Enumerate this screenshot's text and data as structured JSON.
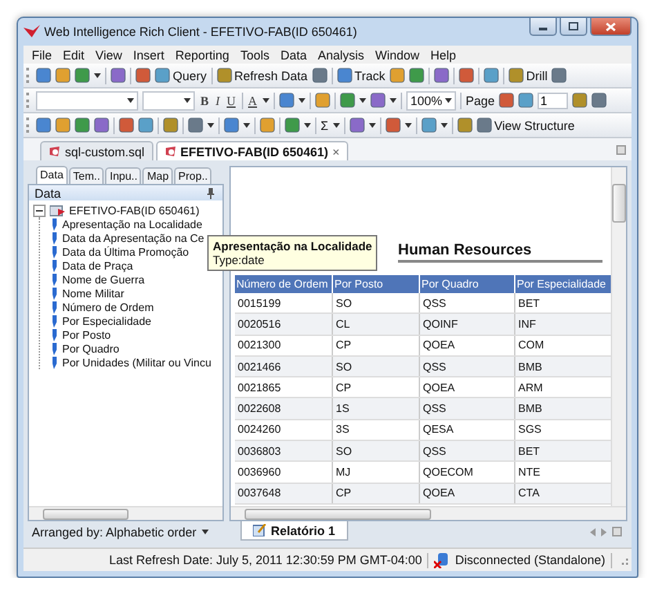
{
  "window": {
    "title": "Web Intelligence Rich Client - EFETIVO-FAB(ID 650461)"
  },
  "menu": [
    "File",
    "Edit",
    "View",
    "Insert",
    "Reporting",
    "Tools",
    "Data",
    "Analysis",
    "Window",
    "Help"
  ],
  "toolbars": [
    [
      {
        "kind": "icon"
      },
      {
        "kind": "icon"
      },
      {
        "kind": "icon"
      },
      {
        "kind": "caret"
      },
      {
        "kind": "sep"
      },
      {
        "kind": "icon"
      },
      {
        "kind": "sep"
      },
      {
        "kind": "icon"
      },
      {
        "kind": "button",
        "label": "Query"
      },
      {
        "kind": "sep"
      },
      {
        "kind": "button",
        "label": "Refresh Data"
      },
      {
        "kind": "icon"
      },
      {
        "kind": "sep"
      },
      {
        "kind": "button",
        "label": "Track"
      },
      {
        "kind": "icon"
      },
      {
        "kind": "icon"
      },
      {
        "kind": "sep"
      },
      {
        "kind": "icon"
      },
      {
        "kind": "sep"
      },
      {
        "kind": "icon"
      },
      {
        "kind": "sep"
      },
      {
        "kind": "icon"
      },
      {
        "kind": "sep"
      },
      {
        "kind": "button",
        "label": "Drill"
      },
      {
        "kind": "icon"
      }
    ],
    [
      {
        "kind": "font-combo"
      },
      {
        "kind": "size-combo"
      },
      {
        "kind": "bold",
        "label": "B"
      },
      {
        "kind": "italic",
        "label": "I"
      },
      {
        "kind": "underline",
        "label": "U"
      },
      {
        "kind": "sep"
      },
      {
        "kind": "underline",
        "label": "A"
      },
      {
        "kind": "caret"
      },
      {
        "kind": "sep"
      },
      {
        "kind": "icon"
      },
      {
        "kind": "caret"
      },
      {
        "kind": "sep"
      },
      {
        "kind": "icon"
      },
      {
        "kind": "sep"
      },
      {
        "kind": "icon"
      },
      {
        "kind": "caret"
      },
      {
        "kind": "icon"
      },
      {
        "kind": "caret"
      },
      {
        "kind": "sep"
      },
      {
        "kind": "zoom",
        "label": "100%"
      },
      {
        "kind": "sep"
      },
      {
        "kind": "text",
        "label": "Page"
      },
      {
        "kind": "icon"
      },
      {
        "kind": "icon"
      },
      {
        "kind": "page-field",
        "value": "1"
      },
      {
        "kind": "icon"
      },
      {
        "kind": "icon"
      }
    ],
    [
      {
        "kind": "icon"
      },
      {
        "kind": "icon"
      },
      {
        "kind": "icon"
      },
      {
        "kind": "icon"
      },
      {
        "kind": "sep"
      },
      {
        "kind": "icon"
      },
      {
        "kind": "icon"
      },
      {
        "kind": "sep"
      },
      {
        "kind": "icon"
      },
      {
        "kind": "sep"
      },
      {
        "kind": "icon"
      },
      {
        "kind": "caret"
      },
      {
        "kind": "sep"
      },
      {
        "kind": "icon"
      },
      {
        "kind": "caret"
      },
      {
        "kind": "sep"
      },
      {
        "kind": "icon"
      },
      {
        "kind": "sep"
      },
      {
        "kind": "icon"
      },
      {
        "kind": "caret"
      },
      {
        "kind": "sep"
      },
      {
        "kind": "text",
        "label": "Σ"
      },
      {
        "kind": "caret"
      },
      {
        "kind": "sep"
      },
      {
        "kind": "icon"
      },
      {
        "kind": "caret"
      },
      {
        "kind": "sep"
      },
      {
        "kind": "icon"
      },
      {
        "kind": "caret"
      },
      {
        "kind": "sep"
      },
      {
        "kind": "icon"
      },
      {
        "kind": "caret"
      },
      {
        "kind": "sep"
      },
      {
        "kind": "icon"
      },
      {
        "kind": "button",
        "label": "View Structure"
      }
    ]
  ],
  "document_tabs": [
    {
      "label": "sql-custom.sql",
      "selected": false
    },
    {
      "label": "EFETIVO-FAB(ID 650461)",
      "selected": true,
      "close": "×"
    }
  ],
  "side_panel": {
    "tabs": [
      {
        "label": "Data",
        "selected": true
      },
      {
        "label": "Tem..",
        "selected": false
      },
      {
        "label": "Inpu..",
        "selected": false
      },
      {
        "label": "Map",
        "selected": false
      },
      {
        "label": "Prop..",
        "selected": false
      }
    ],
    "header": "Data",
    "tree": [
      {
        "label": "EFETIVO-FAB(ID 650461)",
        "expanded": true,
        "children": [
          {
            "label": "Apresentação na Localidade"
          },
          {
            "label": "Data da Apresentação na Ce"
          },
          {
            "label": "Data da Última Promoção"
          },
          {
            "label": "Data de Praça"
          },
          {
            "label": "Nome de Guerra"
          },
          {
            "label": "Nome  Militar"
          },
          {
            "label": "Número de Ordem"
          },
          {
            "label": "Por Especialidade"
          },
          {
            "label": "Por Posto"
          },
          {
            "label": "Por Quadro"
          },
          {
            "label": "Por Unidades (Militar ou Vincu"
          }
        ]
      }
    ],
    "footer": "Arranged by: Alphabetic order"
  },
  "tooltip": {
    "title": "Apresentação na Localidade",
    "detail": "Type:date"
  },
  "report": {
    "title": "Human Resources",
    "table": {
      "columns": [
        "Número de Ordem",
        "Por Posto",
        "Por Quadro",
        "Por Especialidade"
      ],
      "rows": [
        [
          "0015199",
          "SO",
          "QSS",
          "BET"
        ],
        [
          "0020516",
          "CL",
          "QOINF",
          "INF"
        ],
        [
          "0021300",
          "CP",
          "QOEA",
          "COM"
        ],
        [
          "0021466",
          "SO",
          "QSS",
          "BMB"
        ],
        [
          "0021865",
          "CP",
          "QOEA",
          "ARM"
        ],
        [
          "0022608",
          "1S",
          "QSS",
          "BMB"
        ],
        [
          "0024260",
          "3S",
          "QESA",
          "SGS"
        ],
        [
          "0036803",
          "SO",
          "QSS",
          "BET"
        ],
        [
          "0036960",
          "MJ",
          "QOECOM",
          "NTE"
        ],
        [
          "0037648",
          "CP",
          "QOEA",
          "CTA"
        ]
      ]
    }
  },
  "report_tabs": [
    {
      "label": "Relatório 1",
      "selected": true
    }
  ],
  "status_bar": {
    "refresh": "Last Refresh Date: July 5, 2011 12:30:59 PM GMT-04:00",
    "connection": "Disconnected (Standalone)"
  }
}
